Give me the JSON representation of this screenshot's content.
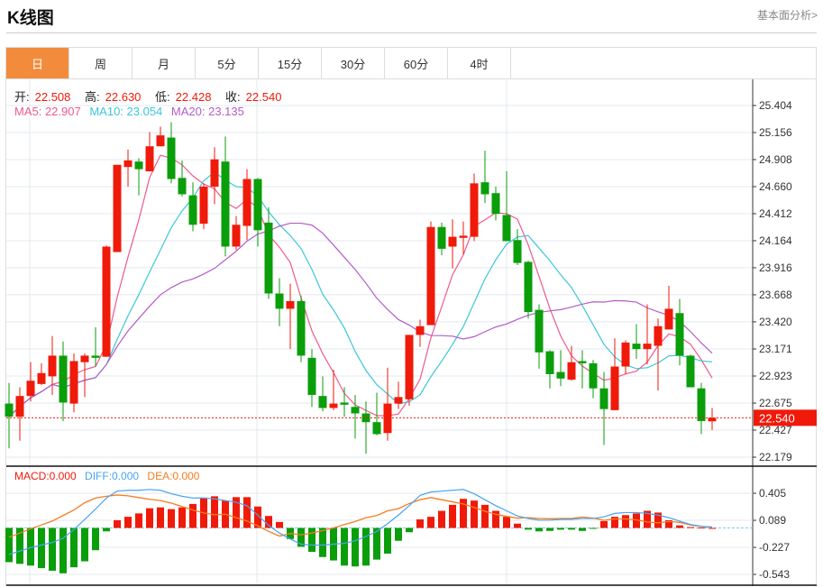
{
  "header": {
    "title": "K线图",
    "link": "基本面分析>"
  },
  "tabs": [
    "日",
    "周",
    "月",
    "5分",
    "15分",
    "30分",
    "60分",
    "4时"
  ],
  "active_tab": 0,
  "ohlc_legend": {
    "open_label": "开:",
    "open": "22.508",
    "high_label": "高:",
    "high": "22.630",
    "low_label": "低:",
    "low": "22.428",
    "close_label": "收:",
    "close": "22.540"
  },
  "ma_legend": {
    "ma5": "MA5: 22.907",
    "ma10": "MA10: 23.054",
    "ma20": "MA20: 23.135"
  },
  "macd_legend": {
    "macd": "MACD:0.000",
    "diff": "DIFF:0.000",
    "dea": "DEA:0.000"
  },
  "colors": {
    "up": "#f01a0a",
    "down": "#0a9e0a",
    "ma5": "#ee5a8c",
    "ma10": "#3cc6da",
    "ma20": "#b45cc8",
    "diff": "#4aa3f0",
    "dea": "#f57c20",
    "accent": "#f28c3c"
  },
  "chart_data": [
    {
      "type": "candlestick",
      "title": "K线图",
      "ylim": [
        22.179,
        25.404
      ],
      "y_ticks": [
        "25.404",
        "25.156",
        "24.908",
        "24.660",
        "24.412",
        "24.164",
        "23.916",
        "23.668",
        "23.420",
        "23.171",
        "22.923",
        "22.675",
        "22.427",
        "22.179"
      ],
      "current_price": "22.540",
      "ohlc": [
        [
          22.67,
          22.86,
          22.26,
          22.55
        ],
        [
          22.55,
          22.82,
          22.33,
          22.74
        ],
        [
          22.74,
          23.05,
          22.69,
          22.88
        ],
        [
          22.85,
          23.04,
          22.84,
          22.95
        ],
        [
          22.92,
          23.29,
          22.75,
          23.11
        ],
        [
          23.11,
          23.24,
          22.51,
          22.68
        ],
        [
          22.67,
          23.13,
          22.59,
          23.06
        ],
        [
          23.05,
          23.13,
          22.73,
          23.11
        ],
        [
          23.11,
          23.37,
          23.01,
          23.09
        ],
        [
          23.1,
          24.12,
          23.1,
          24.11
        ],
        [
          24.06,
          24.86,
          24.06,
          24.86
        ],
        [
          24.84,
          25.0,
          24.66,
          24.9
        ],
        [
          24.89,
          24.92,
          24.58,
          24.82
        ],
        [
          24.8,
          25.16,
          24.8,
          25.03
        ],
        [
          25.03,
          25.21,
          25.03,
          25.13
        ],
        [
          25.11,
          25.25,
          24.69,
          24.73
        ],
        [
          24.74,
          24.9,
          24.57,
          24.59
        ],
        [
          24.58,
          24.7,
          24.25,
          24.31
        ],
        [
          24.32,
          24.69,
          24.27,
          24.66
        ],
        [
          24.66,
          25.02,
          24.5,
          24.91
        ],
        [
          24.89,
          25.12,
          24.02,
          24.11
        ],
        [
          24.11,
          24.39,
          24.08,
          24.31
        ],
        [
          24.3,
          24.82,
          24.17,
          24.73
        ],
        [
          24.73,
          24.74,
          24.11,
          24.26
        ],
        [
          24.33,
          24.47,
          23.63,
          23.68
        ],
        [
          23.68,
          23.82,
          23.38,
          23.54
        ],
        [
          23.54,
          23.77,
          23.17,
          23.61
        ],
        [
          23.61,
          23.66,
          23.05,
          23.11
        ],
        [
          23.09,
          23.17,
          22.64,
          22.75
        ],
        [
          22.74,
          22.92,
          22.6,
          22.63
        ],
        [
          22.63,
          22.98,
          22.61,
          22.67
        ],
        [
          22.68,
          22.82,
          22.55,
          22.66
        ],
        [
          22.64,
          22.75,
          22.35,
          22.58
        ],
        [
          22.58,
          22.69,
          22.21,
          22.5
        ],
        [
          22.5,
          22.77,
          22.38,
          22.39
        ],
        [
          22.4,
          23.0,
          22.33,
          22.67
        ],
        [
          22.67,
          22.87,
          22.62,
          22.73
        ],
        [
          22.71,
          23.3,
          22.65,
          23.3
        ],
        [
          23.3,
          23.44,
          23.19,
          23.38
        ],
        [
          23.39,
          24.34,
          23.39,
          24.29
        ],
        [
          24.29,
          24.33,
          24.03,
          24.09
        ],
        [
          24.11,
          24.36,
          23.91,
          24.2
        ],
        [
          24.19,
          24.34,
          24.04,
          24.21
        ],
        [
          24.2,
          24.78,
          24.16,
          24.69
        ],
        [
          24.7,
          24.99,
          24.51,
          24.59
        ],
        [
          24.6,
          24.66,
          24.35,
          24.41
        ],
        [
          24.4,
          24.8,
          24.16,
          24.16
        ],
        [
          24.17,
          24.27,
          23.94,
          23.96
        ],
        [
          23.97,
          23.98,
          23.45,
          23.51
        ],
        [
          23.53,
          23.58,
          22.99,
          23.14
        ],
        [
          23.15,
          23.16,
          22.81,
          22.94
        ],
        [
          22.96,
          23.16,
          22.83,
          22.9
        ],
        [
          22.89,
          23.2,
          22.88,
          23.05
        ],
        [
          23.06,
          23.16,
          22.81,
          23.04
        ],
        [
          23.04,
          23.07,
          22.72,
          22.81
        ],
        [
          22.81,
          22.96,
          22.29,
          22.62
        ],
        [
          22.61,
          23.27,
          22.61,
          23.01
        ],
        [
          23.01,
          23.25,
          22.94,
          23.23
        ],
        [
          23.22,
          23.4,
          23.08,
          23.17
        ],
        [
          23.17,
          23.58,
          23.03,
          23.22
        ],
        [
          23.2,
          23.45,
          22.79,
          23.38
        ],
        [
          23.35,
          23.75,
          23.35,
          23.54
        ],
        [
          23.5,
          23.63,
          23.02,
          23.11
        ],
        [
          23.11,
          23.12,
          22.82,
          22.82
        ],
        [
          22.81,
          22.86,
          22.39,
          22.51
        ],
        [
          22.508,
          22.63,
          22.428,
          22.54
        ]
      ],
      "ma_periods": [
        5,
        10,
        20
      ]
    },
    {
      "type": "bar+line",
      "title": "MACD",
      "ylim": [
        -0.62,
        0.5
      ],
      "y_ticks": [
        "0.405",
        "0.089",
        "-0.227",
        "-0.543"
      ],
      "histogram": [
        -0.4,
        -0.42,
        -0.44,
        -0.47,
        -0.5,
        -0.53,
        -0.46,
        -0.39,
        -0.26,
        -0.04,
        0.09,
        0.13,
        0.17,
        0.23,
        0.24,
        0.22,
        0.24,
        0.28,
        0.35,
        0.37,
        0.32,
        0.36,
        0.36,
        0.25,
        0.14,
        0.07,
        -0.13,
        -0.22,
        -0.28,
        -0.34,
        -0.38,
        -0.44,
        -0.45,
        -0.44,
        -0.37,
        -0.3,
        -0.15,
        -0.05,
        0.1,
        0.13,
        0.2,
        0.27,
        0.34,
        0.32,
        0.27,
        0.2,
        0.13,
        0.05,
        -0.02,
        -0.04,
        -0.035,
        -0.02,
        -0.02,
        -0.035,
        -0.01,
        0.08,
        0.13,
        0.15,
        0.17,
        0.2,
        0.18,
        0.09,
        0.03,
        0.01,
        0.005,
        0.0
      ],
      "diff": [
        -0.31,
        -0.27,
        -0.23,
        -0.2,
        -0.17,
        -0.12,
        -0.02,
        0.1,
        0.22,
        0.35,
        0.43,
        0.44,
        0.44,
        0.45,
        0.44,
        0.4,
        0.37,
        0.35,
        0.35,
        0.34,
        0.32,
        0.3,
        0.26,
        0.15,
        0.03,
        -0.06,
        -0.13,
        -0.19,
        -0.2,
        -0.2,
        -0.19,
        -0.18,
        -0.15,
        -0.1,
        -0.04,
        0.05,
        0.15,
        0.26,
        0.38,
        0.42,
        0.43,
        0.44,
        0.45,
        0.4,
        0.33,
        0.26,
        0.2,
        0.14,
        0.11,
        0.09,
        0.09,
        0.1,
        0.1,
        0.11,
        0.11,
        0.13,
        0.17,
        0.18,
        0.18,
        0.17,
        0.15,
        0.12,
        0.08,
        0.04,
        0.02,
        0.01
      ]
    }
  ]
}
